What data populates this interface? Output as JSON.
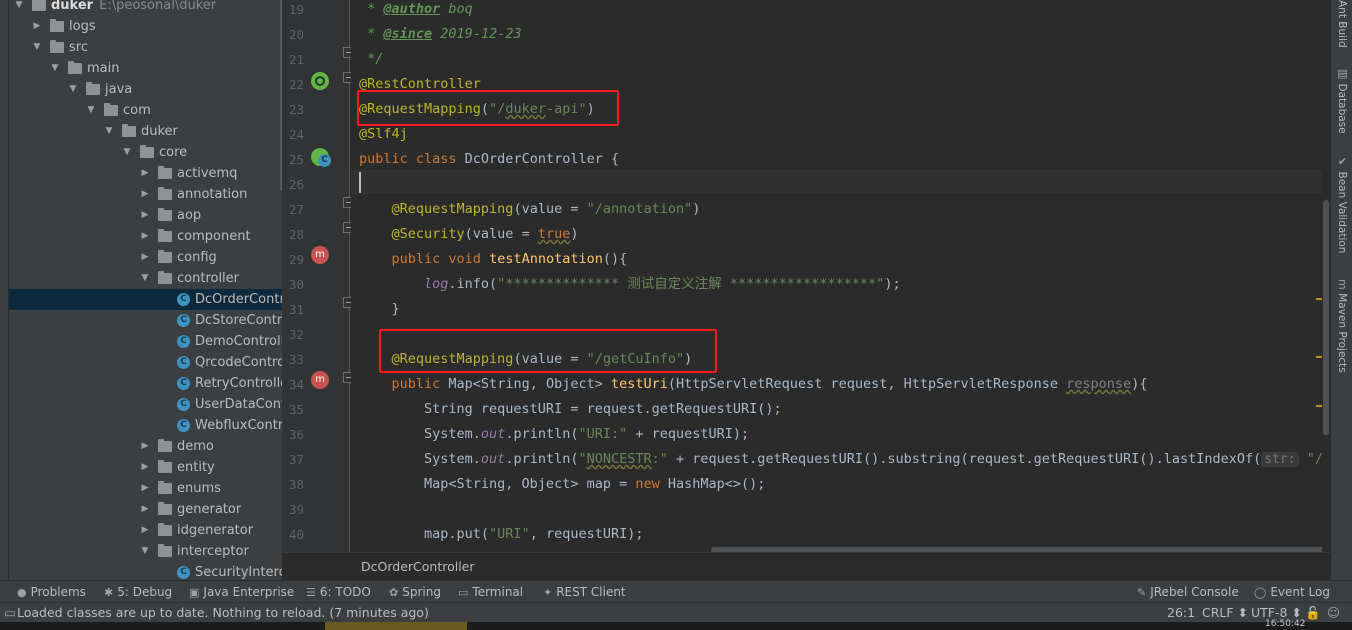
{
  "project_tree": [
    {
      "label": "duker",
      "path": "E:\\peosonal\\duker",
      "depth": 0,
      "expanded": true,
      "kind": "folder",
      "bold": true
    },
    {
      "label": "logs",
      "depth": 1,
      "expanded": false,
      "kind": "folder"
    },
    {
      "label": "src",
      "depth": 1,
      "expanded": true,
      "kind": "folder"
    },
    {
      "label": "main",
      "depth": 2,
      "expanded": true,
      "kind": "folder"
    },
    {
      "label": "java",
      "depth": 3,
      "expanded": true,
      "kind": "folder"
    },
    {
      "label": "com",
      "depth": 4,
      "expanded": true,
      "kind": "folder"
    },
    {
      "label": "duker",
      "depth": 5,
      "expanded": true,
      "kind": "folder"
    },
    {
      "label": "core",
      "depth": 6,
      "expanded": true,
      "kind": "folder"
    },
    {
      "label": "activemq",
      "depth": 7,
      "expanded": false,
      "kind": "folder"
    },
    {
      "label": "annotation",
      "depth": 7,
      "expanded": false,
      "kind": "folder"
    },
    {
      "label": "aop",
      "depth": 7,
      "expanded": false,
      "kind": "folder"
    },
    {
      "label": "component",
      "depth": 7,
      "expanded": false,
      "kind": "folder"
    },
    {
      "label": "config",
      "depth": 7,
      "expanded": false,
      "kind": "folder"
    },
    {
      "label": "controller",
      "depth": 7,
      "expanded": true,
      "kind": "folder"
    },
    {
      "label": "DcOrderContro",
      "depth": 8,
      "kind": "class",
      "selected": true
    },
    {
      "label": "DcStoreControl",
      "depth": 8,
      "kind": "class"
    },
    {
      "label": "DemoController",
      "depth": 8,
      "kind": "class"
    },
    {
      "label": "QrcodeControll",
      "depth": 8,
      "kind": "class"
    },
    {
      "label": "RetryController",
      "depth": 8,
      "kind": "class"
    },
    {
      "label": "UserDataContro",
      "depth": 8,
      "kind": "class"
    },
    {
      "label": "WebfluxControl",
      "depth": 8,
      "kind": "class"
    },
    {
      "label": "demo",
      "depth": 7,
      "expanded": false,
      "kind": "folder"
    },
    {
      "label": "entity",
      "depth": 7,
      "expanded": false,
      "kind": "folder"
    },
    {
      "label": "enums",
      "depth": 7,
      "expanded": false,
      "kind": "folder"
    },
    {
      "label": "generator",
      "depth": 7,
      "expanded": false,
      "kind": "folder"
    },
    {
      "label": "idgenerator",
      "depth": 7,
      "expanded": false,
      "kind": "folder"
    },
    {
      "label": "interceptor",
      "depth": 7,
      "expanded": true,
      "kind": "folder"
    },
    {
      "label": "SecurityIntercep",
      "depth": 8,
      "kind": "class"
    }
  ],
  "editor": {
    "current_line": 26,
    "lines": [
      {
        "n": 19,
        "html": "<span class=\"cmt\"> * </span><span class=\"cmtk\">@author</span><span class=\"cmt\"> boq</span>"
      },
      {
        "n": 20,
        "html": "<span class=\"cmt\"> * </span><span class=\"cmtk\">@since</span><span class=\"cmt\"> 2019-12-23</span>"
      },
      {
        "n": 21,
        "html": "<span class=\"cmt\"> */</span>"
      },
      {
        "n": 22,
        "html": "<span class=\"ann\">@RestController</span>"
      },
      {
        "n": 23,
        "html": "<span class=\"ann\">@RequestMapping</span>(<span class=\"str\">\"/<span class=\"wave\">duker</span>-api\"</span>)"
      },
      {
        "n": 24,
        "html": "<span class=\"ann\">@Slf4j</span>"
      },
      {
        "n": 25,
        "html": "<span class=\"kw\">public class </span>DcOrderController {"
      },
      {
        "n": 26,
        "html": ""
      },
      {
        "n": 27,
        "html": "    <span class=\"ann\">@RequestMapping</span>(value = <span class=\"str\">\"/annotation\"</span>)"
      },
      {
        "n": 28,
        "html": "    <span class=\"ann\">@Security</span>(value = <span class=\"kw wave\">true</span>)"
      },
      {
        "n": 29,
        "html": "    <span class=\"kw\">public void </span><span class=\"fn\">testAnnotation</span>(){"
      },
      {
        "n": 30,
        "html": "        <span class=\"fld\">log</span>.info(<span class=\"str\">\"************** 测试自定义注解 ******************\"</span>);"
      },
      {
        "n": 31,
        "html": "    }"
      },
      {
        "n": 32,
        "html": ""
      },
      {
        "n": 33,
        "html": "    <span class=\"ann\">@RequestMapping</span>(value = <span class=\"str\">\"/getCuInfo\"</span>)"
      },
      {
        "n": 34,
        "html": "    <span class=\"kw\">public </span>Map&lt;String, Object&gt; <span class=\"fn\">testUri</span>(HttpServletRequest request, HttpServletResponse <span class=\"gray wave\">response</span>){"
      },
      {
        "n": 35,
        "html": "        String requestURI = request.getRequestURI();"
      },
      {
        "n": 36,
        "html": "        System.<span class=\"fld\">out</span>.println(<span class=\"str\">\"URI:\"</span> + requestURI);"
      },
      {
        "n": 37,
        "html": "        System.<span class=\"fld\">out</span>.println(<span class=\"str\">\"<span class=\"wave\">NONCESTR</span>:\"</span> + request.getRequestURI().substring(request.getRequestURI().lastIndexOf(<span class=\"hint\">str:</span> <span class=\"str\">\"/\"</span>) +"
      },
      {
        "n": 38,
        "html": "        Map&lt;String, Object&gt; map = <span class=\"kw\">new </span>HashMap&lt;&gt;();"
      },
      {
        "n": 39,
        "html": ""
      },
      {
        "n": 40,
        "html": "        map.put(<span class=\"str\">\"URI\"</span>, requestURI);"
      }
    ]
  },
  "breadcrumb": "DcOrderController",
  "right_tabs": [
    {
      "label": "Ant Build",
      "icon": "ant-icon"
    },
    {
      "label": "Database",
      "icon": "database-icon"
    },
    {
      "label": "Bean Validation",
      "icon": "bean-validation-icon"
    },
    {
      "label": "Maven Projects",
      "icon": "maven-icon"
    }
  ],
  "tool_windows": [
    {
      "label": "Problems",
      "icon": "problems-icon",
      "glyph": "●"
    },
    {
      "label": "5: Debug",
      "icon": "debug-icon",
      "glyph": "✱"
    },
    {
      "label": "Java Enterprise",
      "icon": "java-enterprise-icon",
      "glyph": "▣"
    },
    {
      "label": "6: TODO",
      "icon": "todo-icon",
      "glyph": "☰"
    },
    {
      "label": "Spring",
      "icon": "spring-icon",
      "glyph": "✿"
    },
    {
      "label": "Terminal",
      "icon": "terminal-icon",
      "glyph": "▭"
    },
    {
      "label": "REST Client",
      "icon": "rest-client-icon",
      "glyph": "✦"
    }
  ],
  "tool_windows_right": [
    {
      "label": "JRebel Console",
      "icon": "jrebel-icon",
      "glyph": "✎"
    },
    {
      "label": "Event Log",
      "icon": "event-log-icon",
      "glyph": "◯"
    }
  ],
  "status": {
    "message": "Loaded classes are up to date. Nothing to reload. (7 minutes ago)",
    "position": "26:1",
    "line_sep": "CRLF",
    "encoding": "UTF-8"
  },
  "clock": "16:50:42"
}
